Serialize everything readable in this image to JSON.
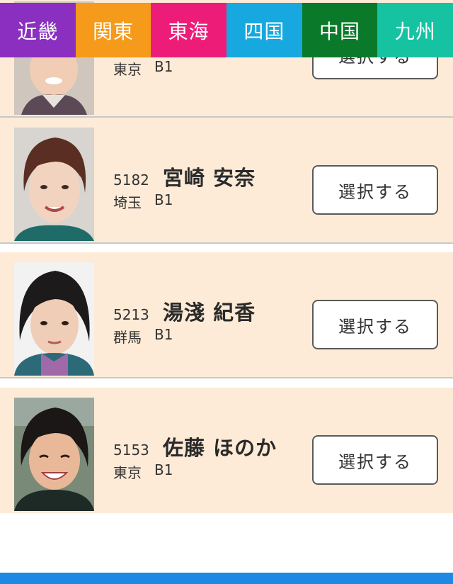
{
  "tabs": [
    {
      "label": "近畿",
      "color": "#8a2fc0"
    },
    {
      "label": "関東",
      "color": "#f59a1b"
    },
    {
      "label": "東海",
      "color": "#ee1c79"
    },
    {
      "label": "四国",
      "color": "#16a8de"
    },
    {
      "label": "中国",
      "color": "#0a7a2a"
    },
    {
      "label": "九州",
      "color": "#15c3a3"
    }
  ],
  "racers": [
    {
      "number": "",
      "name": "",
      "prefecture": "東京",
      "class": "B1",
      "button": "選択する"
    },
    {
      "number": "5182",
      "name": "宮崎 安奈",
      "prefecture": "埼玉",
      "class": "B1",
      "button": "選択する"
    },
    {
      "number": "5213",
      "name": "湯淺 紀香",
      "prefecture": "群馬",
      "class": "B1",
      "button": "選択する"
    },
    {
      "number": "5153",
      "name": "佐藤 ほのか",
      "prefecture": "東京",
      "class": "B1",
      "button": "選択する"
    }
  ],
  "colors": {
    "row_bg": "#fdebd7",
    "footer_bar": "#1e88e5"
  }
}
